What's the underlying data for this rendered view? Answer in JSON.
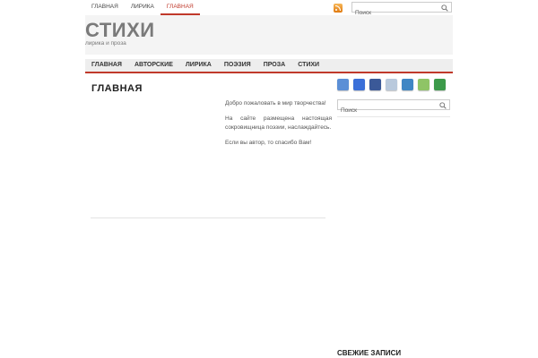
{
  "top_nav": [
    {
      "label": "главная",
      "active": false
    },
    {
      "label": "лирика",
      "active": false
    },
    {
      "label": "главная",
      "active": true
    }
  ],
  "top_search": {
    "placeholder": "Поиск"
  },
  "site": {
    "title": "СТИХИ",
    "description": "лирика и проза"
  },
  "main_nav": [
    {
      "label": "Главная"
    },
    {
      "label": "Авторские"
    },
    {
      "label": "Лирика"
    },
    {
      "label": "Поэзия"
    },
    {
      "label": "Проза"
    },
    {
      "label": "Стихи"
    }
  ],
  "page": {
    "title": "ГЛАВНАЯ",
    "paragraphs": [
      "Добро пожаловать в мир творчества!",
      "На сайте размещена настоящая сокровищница поэзии, наслаждайтесь.",
      "Если вы автор, то спасибо Вам!"
    ]
  },
  "sidebar": {
    "social_icons": [
      {
        "name": "twitter-icon",
        "color": "#5b8fd6"
      },
      {
        "name": "delicious-icon",
        "color": "#3a6fd8"
      },
      {
        "name": "facebook-icon",
        "color": "#3b5998"
      },
      {
        "name": "digg-icon",
        "color": "#b9c9dc"
      },
      {
        "name": "stumbleupon-icon",
        "color": "#3f86c4"
      },
      {
        "name": "technorati-icon",
        "color": "#8fc466"
      },
      {
        "name": "excel-icon",
        "color": "#3c9a4a"
      }
    ],
    "search": {
      "placeholder": "Поиск"
    },
    "recent_posts_title": "СВЕЖИЕ ЗАПИСИ"
  },
  "colors": {
    "accent": "#c0392b",
    "header_bg": "#f4f4f4",
    "nav_bg": "#eeeeee"
  }
}
